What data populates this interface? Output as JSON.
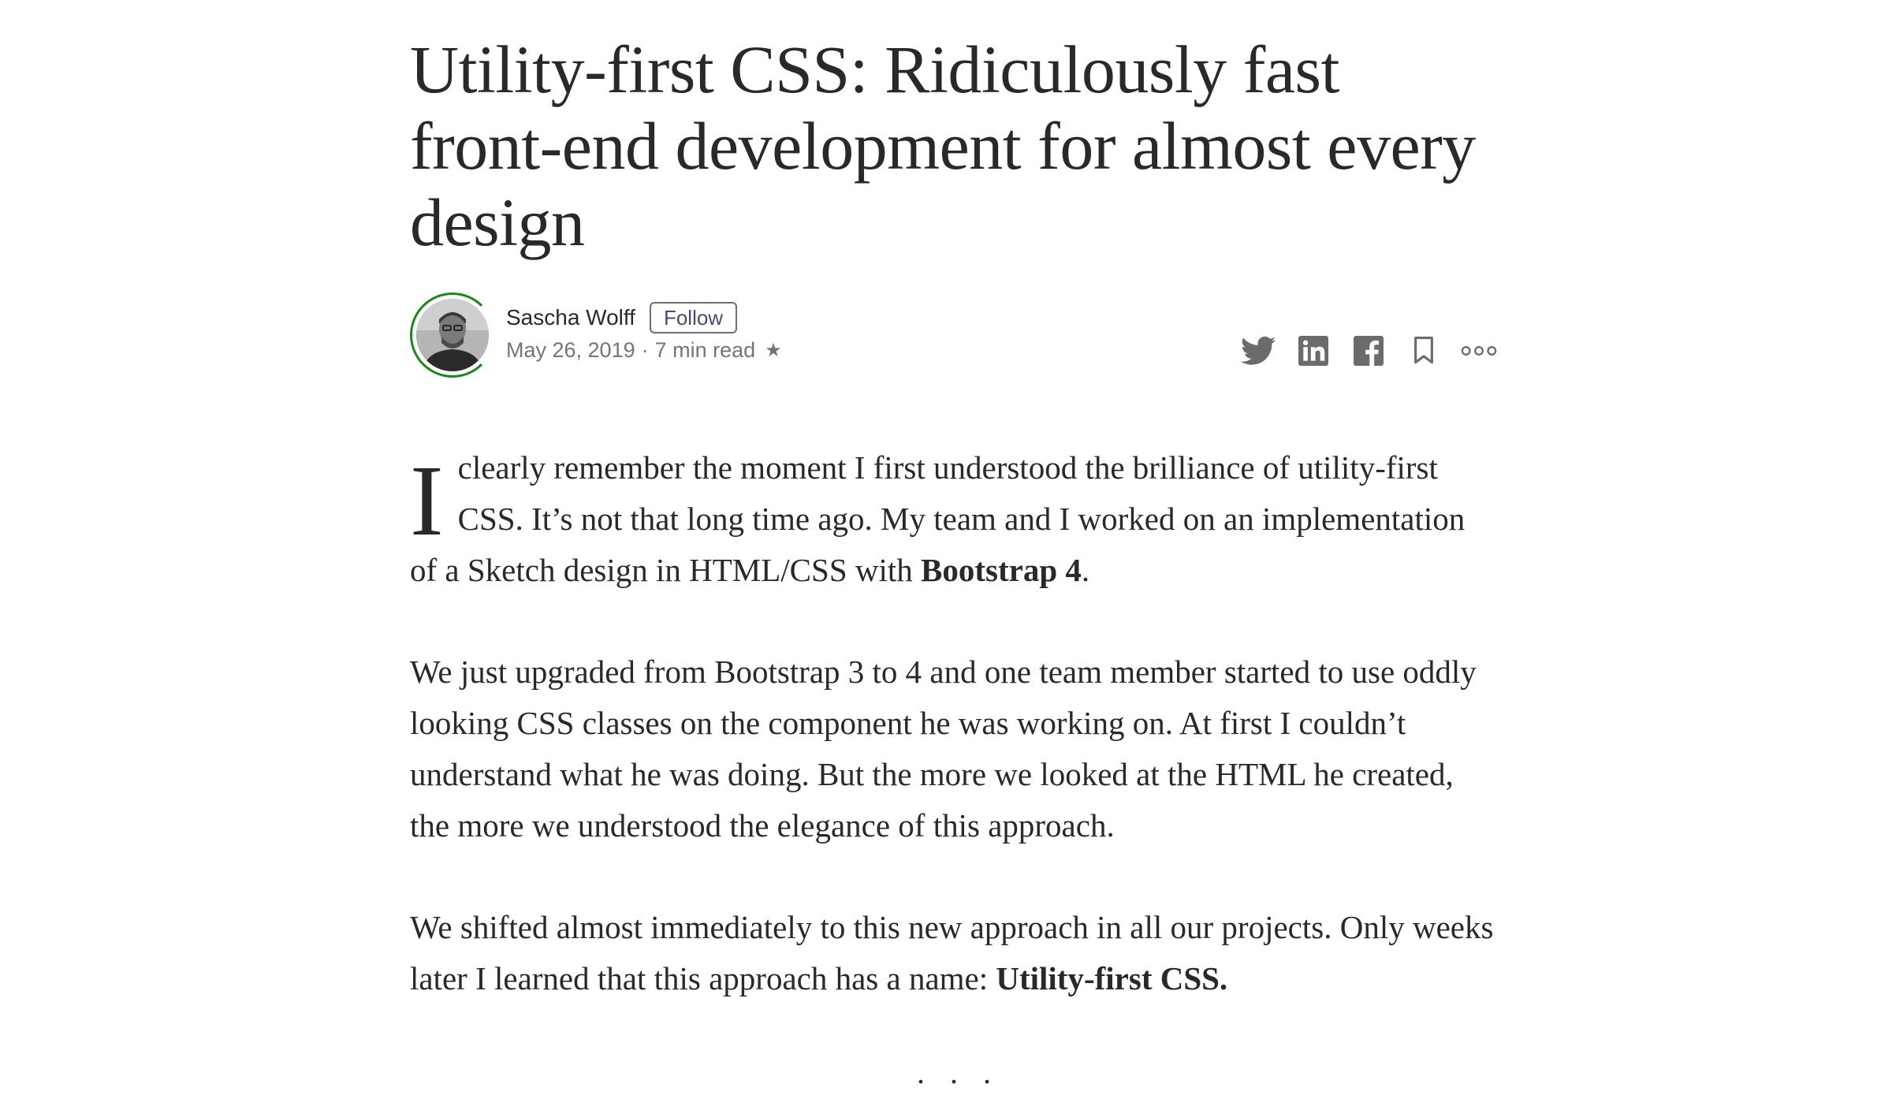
{
  "article": {
    "title": "Utility-first CSS: Ridiculously fast front-end development for almost every design",
    "author": {
      "name": "Sascha Wolff",
      "follow_label": "Follow",
      "date": "May 26, 2019",
      "separator": "·",
      "read_time": "7 min read",
      "star": "★"
    },
    "share_icons": [
      "twitter-icon",
      "linkedin-icon",
      "facebook-icon",
      "bookmark-icon",
      "more-icon"
    ],
    "paragraphs": {
      "p1_dropcap": "I",
      "p1_text": " clearly remember the moment I first understood the brilliance of utility-first CSS. It’s not that long time ago. My team and I worked on an implementation of a Sketch design in HTML/CSS with ",
      "p1_bold": "Bootstrap 4",
      "p1_end": ".",
      "p2_text": "We just upgraded from Bootstrap 3 to 4 and one team member started to use oddly looking CSS classes on the component he was working on. At first I couldn’t understand what he was doing. But the more we looked at the HTML he created, the more we understood the elegance of this approach.",
      "p3_text": "We shifted almost immediately to this new approach in all our projects. Only weeks later I learned that this approach has a name: ",
      "p3_bold": "Utility-first CSS."
    },
    "section_separator": "..."
  },
  "colors": {
    "text": "#292929",
    "meta": "#757575",
    "accent_green": "#1a8917",
    "icon": "#6b6b6b"
  }
}
